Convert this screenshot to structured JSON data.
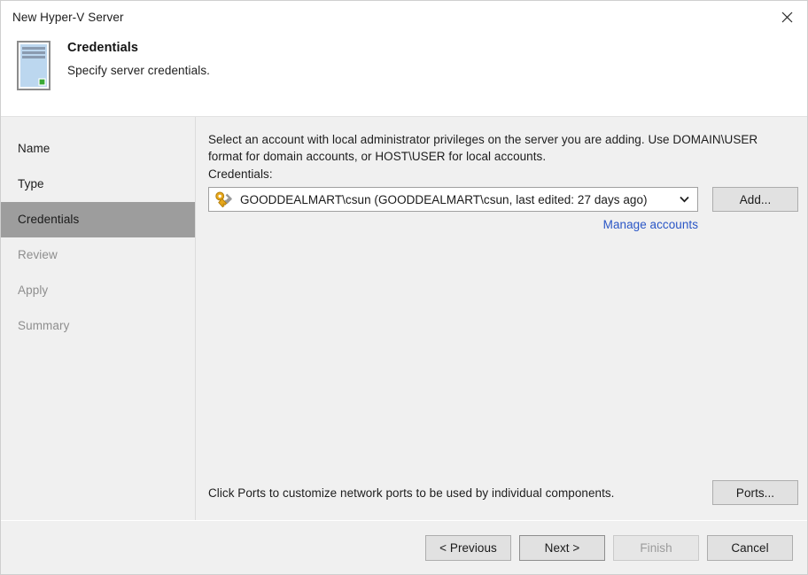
{
  "window": {
    "title": "New Hyper-V Server",
    "close_icon": "close-icon"
  },
  "header": {
    "icon": "server-icon",
    "title": "Credentials",
    "subtitle": "Specify server credentials."
  },
  "sidebar": {
    "items": [
      {
        "label": "Name",
        "state": "normal"
      },
      {
        "label": "Type",
        "state": "normal"
      },
      {
        "label": "Credentials",
        "state": "selected"
      },
      {
        "label": "Review",
        "state": "disabled"
      },
      {
        "label": "Apply",
        "state": "disabled"
      },
      {
        "label": "Summary",
        "state": "disabled"
      }
    ]
  },
  "main": {
    "intro": "Select an account with local administrator privileges on the server you are adding. Use DOMAIN\\USER format for domain accounts, or HOST\\USER for local accounts.",
    "credentials_label": "Credentials:",
    "credential_icon": "key-wrench-icon",
    "credential_value": "GOODDEALMART\\csun (GOODDEALMART\\csun, last edited: 27 days ago)",
    "dropdown_icon": "chevron-down-icon",
    "add_button": "Add...",
    "manage_link": "Manage accounts",
    "ports_text": "Click Ports to customize network ports to be used by individual components.",
    "ports_button": "Ports..."
  },
  "footer": {
    "previous_button": "< Previous",
    "next_button": "Next >",
    "finish_button": "Finish",
    "cancel_button": "Cancel"
  },
  "colors": {
    "panel_bg": "#f0f0f0",
    "selected_nav": "#9d9d9d",
    "link": "#2a56c6",
    "server_body": "#bcd7ef",
    "server_led": "#3aaa35",
    "key_gold": "#e8a81c"
  }
}
